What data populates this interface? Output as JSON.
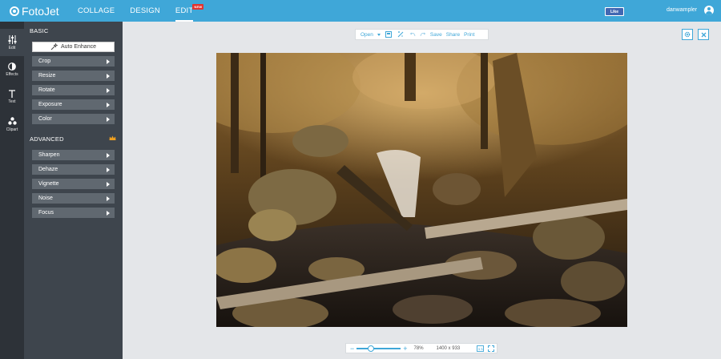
{
  "app": {
    "logo_text": "FotoJet",
    "nav": [
      {
        "label": "COLLAGE"
      },
      {
        "label": "DESIGN"
      },
      {
        "label": "EDIT",
        "badge": "NEW"
      }
    ],
    "fb_like": "Like",
    "username": "danwampler"
  },
  "rail": [
    {
      "label": "Edit",
      "icon": "sliders-icon",
      "active": true
    },
    {
      "label": "Effects",
      "icon": "effects-icon"
    },
    {
      "label": "Text",
      "icon": "text-icon"
    },
    {
      "label": "Clipart",
      "icon": "clipart-icon"
    }
  ],
  "panel": {
    "basic_title": "BASIC",
    "auto_enhance": "Auto Enhance",
    "basic_tools": [
      "Crop",
      "Resize",
      "Rotate",
      "Exposure",
      "Color"
    ],
    "advanced_title": "ADVANCED",
    "advanced_tools": [
      "Sharpen",
      "Dehaze",
      "Vignette",
      "Noise",
      "Focus"
    ]
  },
  "toolbar": {
    "open": "Open",
    "save": "Save",
    "share": "Share",
    "print": "Print"
  },
  "zoom": {
    "minus": "−",
    "plus": "+",
    "percent": "78%",
    "dimensions": "1400 x 933",
    "level": 0.78
  },
  "colors": {
    "brand": "#3fa7d8",
    "rail": "#2d3238",
    "panel": "#3e454d",
    "tool_button": "#606870",
    "badge": "#e2332f",
    "premium": "#f0a020"
  }
}
